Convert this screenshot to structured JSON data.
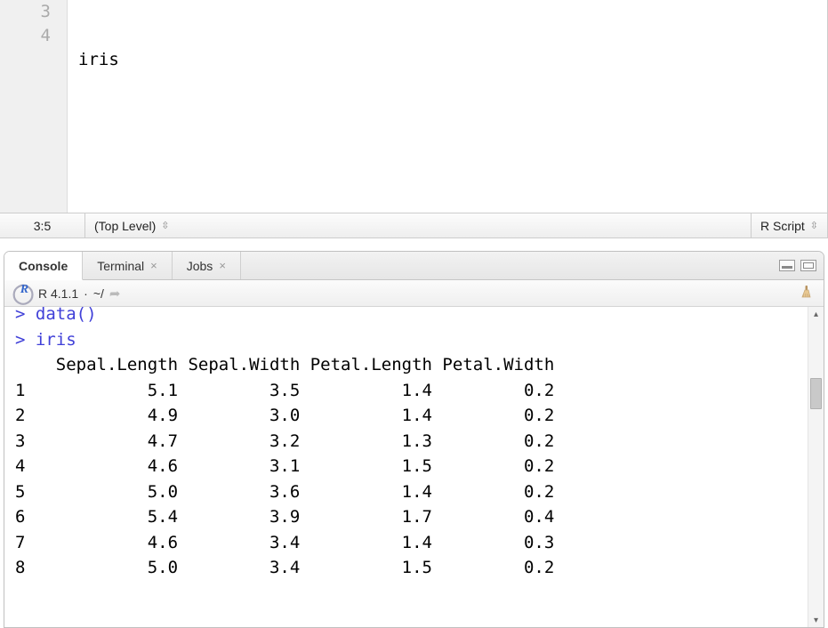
{
  "editor": {
    "lines": [
      {
        "num": "3",
        "text": "iris"
      },
      {
        "num": "4",
        "text": ""
      }
    ]
  },
  "status": {
    "position": "3:5",
    "scope": "(Top Level)",
    "filetype": "R Script"
  },
  "tabs": {
    "console": "Console",
    "terminal": "Terminal",
    "jobs": "Jobs"
  },
  "info": {
    "version": "R 4.1.1",
    "dot": "·",
    "path": "~/"
  },
  "console": {
    "prompt1": "> data()",
    "prompt2": "> iris",
    "header": "    Sepal.Length Sepal.Width Petal.Length Petal.Width",
    "rows": [
      "1            5.1         3.5          1.4         0.2",
      "2            4.9         3.0          1.4         0.2",
      "3            4.7         3.2          1.3         0.2",
      "4            4.6         3.1          1.5         0.2",
      "5            5.0         3.6          1.4         0.2",
      "6            5.4         3.9          1.7         0.4",
      "7            4.6         3.4          1.4         0.3",
      "8            5.0         3.4          1.5         0.2"
    ]
  }
}
